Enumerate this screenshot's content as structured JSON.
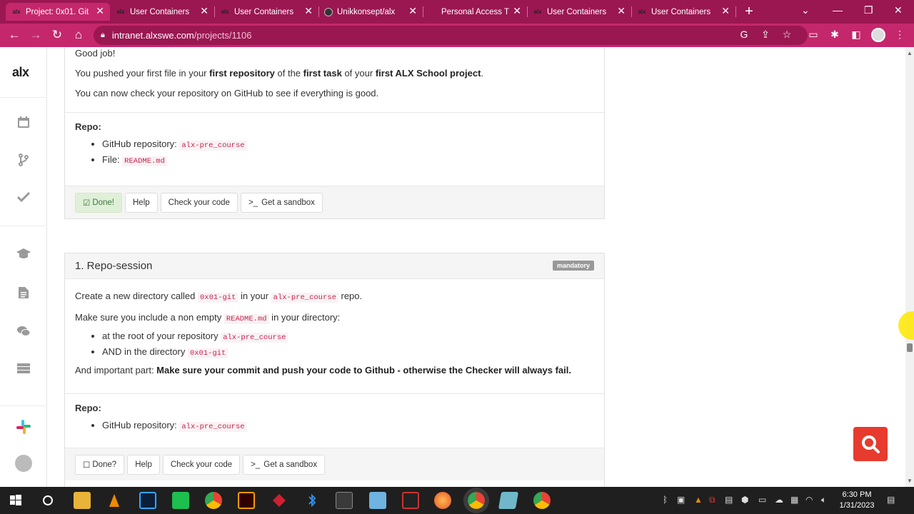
{
  "browser": {
    "tabs": [
      {
        "title": "Project: 0x01. Git",
        "favicon": "alx",
        "active": true
      },
      {
        "title": "User Containers",
        "favicon": "alx",
        "active": false
      },
      {
        "title": "User Containers",
        "favicon": "alx",
        "active": false
      },
      {
        "title": "Unikkonsept/alx",
        "favicon": "github",
        "active": false
      },
      {
        "title": "Personal Access T",
        "favicon": "github",
        "active": false
      },
      {
        "title": "User Containers",
        "favicon": "alx",
        "active": false
      },
      {
        "title": "User Containers",
        "favicon": "alx",
        "active": false
      }
    ],
    "url_host": "intranet.alxswe.com",
    "url_path": "/projects/1106",
    "new_tab": "+"
  },
  "sidebar": {
    "logo": "alx",
    "items": [
      "calendar-icon",
      "branch-icon",
      "check-icon",
      "graduation-cap-icon",
      "document-icon",
      "chat-icon",
      "server-icon"
    ]
  },
  "task0": {
    "intro": "Good job!",
    "line1_pre": "You pushed your first file in your ",
    "line1_b1": "first repository",
    "line1_mid1": " of the ",
    "line1_b2": "first task",
    "line1_mid2": " of your ",
    "line1_b3": "first ALX School project",
    "line1_end": ".",
    "line2": "You can now check your repository on GitHub to see if everything is good.",
    "repo_label": "Repo:",
    "repo_items": [
      {
        "label": "GitHub repository: ",
        "code": "alx-pre_course"
      },
      {
        "label": "File: ",
        "code": "README.md"
      }
    ],
    "buttons": {
      "done": "Done!",
      "help": "Help",
      "check": "Check your code",
      "sandbox": "Get a sandbox"
    }
  },
  "task1": {
    "title": "1. Repo-session",
    "badge": "mandatory",
    "p1_pre": "Create a new directory called ",
    "p1_code1": "0x01-git",
    "p1_mid": " in your ",
    "p1_code2": "alx-pre_course",
    "p1_end": " repo.",
    "p2_pre": "Make sure you include a non empty ",
    "p2_code": "README.md",
    "p2_end": " in your directory:",
    "bullets": [
      {
        "label": "at the root of your repository ",
        "code": "alx-pre_course"
      },
      {
        "label": "AND in the directory ",
        "code": "0x01-git"
      }
    ],
    "p3_pre": "And important part: ",
    "p3_bold": "Make sure your commit and push your code to Github - otherwise the Checker will always fail.",
    "repo_label": "Repo:",
    "repo_items": [
      {
        "label": "GitHub repository: ",
        "code": "alx-pre_course"
      }
    ],
    "buttons": {
      "done": "Done?",
      "help": "Help",
      "check": "Check your code",
      "sandbox": "Get a sandbox"
    }
  },
  "taskbar": {
    "time": "6:30 PM",
    "date": "1/31/2023"
  },
  "colors": {
    "browser_frame": "#9b1752",
    "browser_toolbar": "#c5276c",
    "code_text": "#c7254e",
    "search_fab": "#e63b2e"
  }
}
